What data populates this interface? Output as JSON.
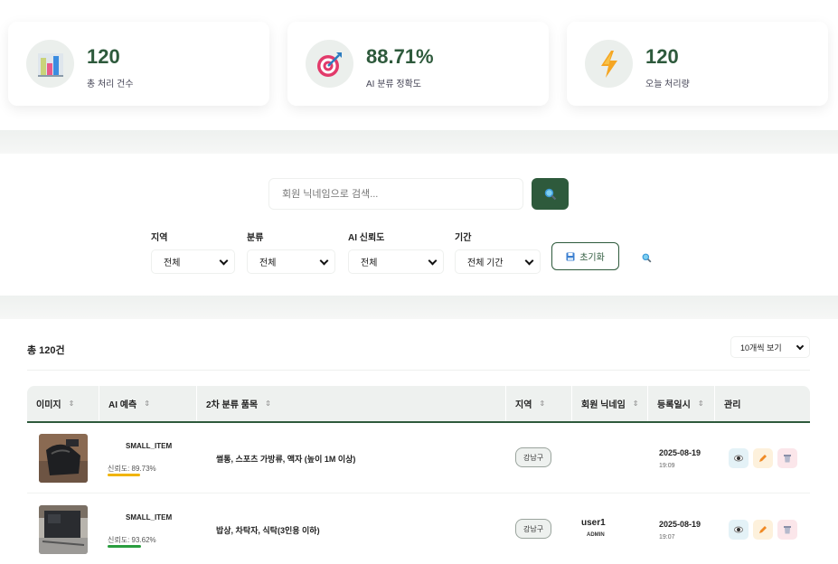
{
  "stats": [
    {
      "value": "120",
      "label": "총 처리 건수",
      "icon": "bar-chart-icon"
    },
    {
      "value": "88.71%",
      "label": "AI 분류 정확도",
      "icon": "target-icon"
    },
    {
      "value": "120",
      "label": "오늘 처리량",
      "icon": "lightning-icon"
    }
  ],
  "search": {
    "placeholder": "회원 닉네임으로 검색..."
  },
  "filters": [
    {
      "label": "지역",
      "value": "전체"
    },
    {
      "label": "분류",
      "value": "전체"
    },
    {
      "label": "AI 신뢰도",
      "value": "전체"
    },
    {
      "label": "기간",
      "value": "전체 기간"
    }
  ],
  "reset_label": "초기화",
  "table": {
    "total": "총 120건",
    "page_size": "10개씩 보기",
    "headers": [
      "이미지",
      "AI 예측",
      "2차 분류 품목",
      "지역",
      "회원 닉네임",
      "등록일시",
      "관리"
    ],
    "rows": [
      {
        "prediction": "SMALL_ITEM",
        "confidence_text": "신뢰도: 89.73%",
        "confidence": 0.8973,
        "conf_color": "#f0b400",
        "category": "썰통, 스포츠 가방류, 액자 (높이 1M 이상)",
        "region": "강남구",
        "nickname": "",
        "role": "",
        "date": "2025-08-19",
        "time": "19:09"
      },
      {
        "prediction": "SMALL_ITEM",
        "confidence_text": "신뢰도: 93.62%",
        "confidence": 0.9362,
        "conf_color": "#2a9d3f",
        "category": "밥상, 차탁자, 식탁(3인용 이하)",
        "region": "강남구",
        "nickname": "user1",
        "role": "ADMIN",
        "date": "2025-08-19",
        "time": "19:07"
      }
    ]
  },
  "colors": {
    "accent": "#2e5a3c",
    "view": "#e4f2f7",
    "edit": "#fdf1dc",
    "delete": "#fbe6ea"
  }
}
